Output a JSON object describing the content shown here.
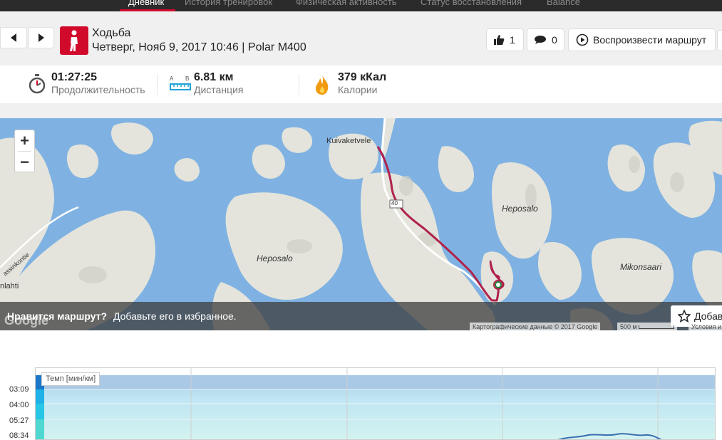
{
  "topnav": {
    "tabs": [
      "Дневник",
      "История тренировок",
      "Физическая активность",
      "Статус восстановления",
      "Balance"
    ],
    "active_index": 0
  },
  "session": {
    "sport": "Ходьба",
    "info": "Четверг, Нояб 9, 2017 10:46 | Polar M400",
    "likes": "1",
    "comments": "0",
    "replay_label": "Воспроизвести маршрут"
  },
  "summary": {
    "duration": {
      "value": "01:27:25",
      "label": "Продолжительность"
    },
    "distance": {
      "value": "6.81 км",
      "label": "Дистанция"
    },
    "calories": {
      "value": "379 кКал",
      "label": "Калории"
    }
  },
  "map": {
    "zoom_in": "+",
    "zoom_out": "−",
    "labels": {
      "kuivaketvele": "Kuivaketvele",
      "heposalo_east": "Heposalo",
      "heposalo_west": "Heposalo",
      "mikonsaari": "Mikonsaari",
      "road": "40",
      "lahti": "nlahti",
      "left_road": "assinkontie"
    },
    "promo_question": "Нравится маршрут?",
    "promo_text": "Добавьте его в избранное.",
    "add_favorite": "Добав",
    "attribution": "Картографические данные © 2017 Google",
    "scale": "500 м",
    "terms": "Условия и",
    "google": "Google"
  },
  "chart": {
    "title": "Темп [мин/км]",
    "y_ticks": [
      "03:09",
      "04:00",
      "05:27",
      "08:34"
    ]
  },
  "colors": {
    "brand_red": "#d10a2c",
    "route": "#b0224b",
    "water": "#7fb2e2",
    "land": "#e4e4dc"
  }
}
